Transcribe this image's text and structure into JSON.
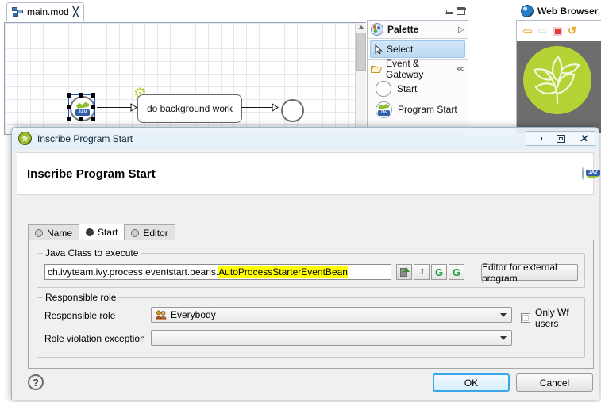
{
  "editor": {
    "tab_label": "main.mod",
    "tab_icon": "process-model-icon",
    "tab_close_glyph": "╳",
    "diagram": {
      "start_node_label": "",
      "task_label": "do background work",
      "end_node_label": "",
      "gear_glyph": "⚙"
    }
  },
  "palette_view": {
    "minimize_label": "Minimize",
    "maximize_label": "Maximize",
    "title": "Palette",
    "collapse_glyph": "▷",
    "select_item": "Select",
    "group_label": "Event & Gateway",
    "group_glyph": "≪",
    "items": [
      {
        "label": "Start",
        "icon": "circle-start-icon"
      },
      {
        "label": "Program Start",
        "icon": "java-program-start-icon"
      }
    ]
  },
  "web_browser": {
    "title": "Web Browser",
    "back_glyph": "⇦",
    "forward_glyph": "⇨",
    "stop_label": "Stop",
    "refresh_glyph": "↺"
  },
  "dialog": {
    "title": "Inscribe Program Start",
    "heading": "Inscribe Program Start",
    "window_buttons": {
      "minimize": "Minimize",
      "restore": "Restore",
      "close": "✕"
    },
    "tabs": [
      {
        "label": "Name",
        "active": false
      },
      {
        "label": "Start",
        "active": true
      },
      {
        "label": "Editor",
        "active": false
      }
    ],
    "java_group": {
      "title": "Java Class to execute",
      "value_prefix": "ch.ivyteam.ivy.process.eventstart.beans.",
      "value_highlight": "AutoProcessStarterEventBean",
      "value_full": "ch.ivyteam.ivy.process.eventstart.beans.AutoProcessStarterEventBean",
      "placeholder": "",
      "buttons": [
        {
          "name": "import-class-button",
          "glyph": ""
        },
        {
          "name": "open-java-file-button",
          "glyph": "J"
        },
        {
          "name": "refresh-button",
          "glyph": "G"
        },
        {
          "name": "new-class-button",
          "glyph": "G"
        }
      ],
      "external_editor_button": "Editor for external program"
    },
    "role_group": {
      "title": "Responsible role",
      "responsible_role_label": "Responsible role",
      "responsible_role_value": "Everybody",
      "violation_label": "Role violation exception",
      "violation_value": "",
      "only_wf_users_label": "Only Wf users",
      "only_wf_users_checked": false
    },
    "footer": {
      "help_glyph": "?",
      "ok_label": "OK",
      "cancel_label": "Cancel"
    }
  },
  "colors": {
    "highlight_yellow": "#ffff00",
    "ok_border_blue": "#3ca7e8",
    "ivy_green": "#b4d334",
    "selection_blue": "#1b54b8"
  }
}
